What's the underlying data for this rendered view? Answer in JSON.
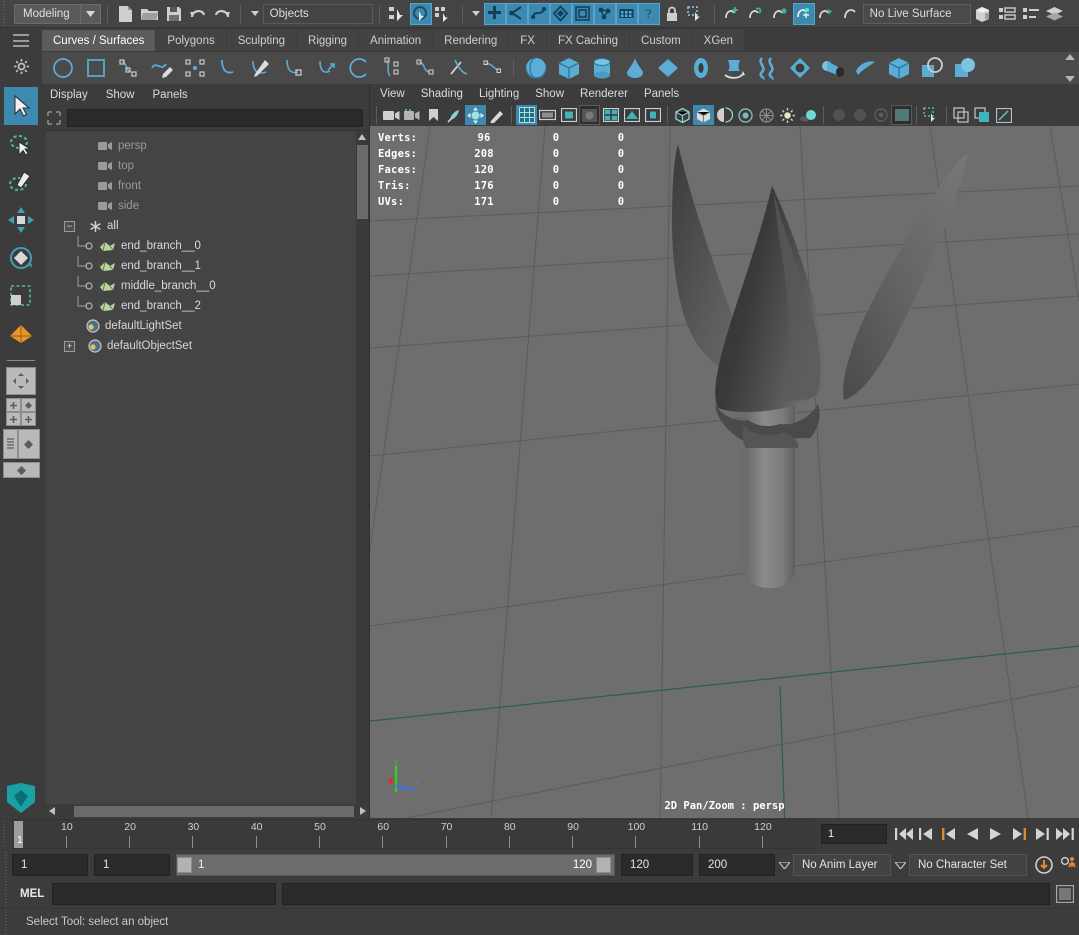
{
  "app": {
    "menu_set": "Modeling",
    "objects_field": "Objects",
    "live_surface": "No Live Surface"
  },
  "shelf": {
    "tabs": [
      {
        "label": "Curves / Surfaces",
        "active": true
      },
      {
        "label": "Polygons",
        "active": false
      },
      {
        "label": "Sculpting",
        "active": false
      },
      {
        "label": "Rigging",
        "active": false
      },
      {
        "label": "Animation",
        "active": false
      },
      {
        "label": "Rendering",
        "active": false
      },
      {
        "label": "FX",
        "active": false
      },
      {
        "label": "FX Caching",
        "active": false
      },
      {
        "label": "Custom",
        "active": false
      },
      {
        "label": "XGen",
        "active": false
      }
    ],
    "curve_icons": [
      "nurbs-circle-icon",
      "nurbs-square-icon",
      "cv-curve-icon",
      "pencil-curve-icon",
      "bezier-curve-icon",
      "curve-arc-icon",
      "curve-cut-icon",
      "insert-knot-icon",
      "extend-curve-icon",
      "arc-three-point-icon",
      "offset-curve-icon",
      "rebuild-curve-icon",
      "curve-fillet-icon",
      "attach-curve-icon"
    ],
    "surface_icons": [
      "sphere-icon",
      "cube-icon",
      "cylinder-icon",
      "cone-icon",
      "plane-icon",
      "torus-icon",
      "revolve-icon",
      "loft-icon",
      "planar-icon",
      "extrude-icon",
      "birail-icon",
      "boundary-cube-icon",
      "intersect-icon",
      "trim-icon"
    ]
  },
  "outliner": {
    "menus": [
      "Display",
      "Show",
      "Panels"
    ],
    "search_value": "",
    "search_placeholder": "",
    "items": [
      {
        "label": "persp",
        "icon": "camera-icon",
        "depth": 2,
        "dim": true
      },
      {
        "label": "top",
        "icon": "camera-icon",
        "depth": 2,
        "dim": true
      },
      {
        "label": "front",
        "icon": "camera-icon",
        "depth": 2,
        "dim": true
      },
      {
        "label": "side",
        "icon": "camera-icon",
        "depth": 2,
        "dim": true
      },
      {
        "label": "all",
        "icon": "set-star-icon",
        "depth": 1,
        "expanded": true,
        "dim": false
      },
      {
        "label": "end_branch__0",
        "icon": "mesh-icon",
        "depth": 3,
        "dim": false
      },
      {
        "label": "end_branch__1",
        "icon": "mesh-icon",
        "depth": 3,
        "dim": false
      },
      {
        "label": "middle_branch__0",
        "icon": "mesh-icon",
        "depth": 3,
        "dim": false
      },
      {
        "label": "end_branch__2",
        "icon": "mesh-icon",
        "depth": 3,
        "dim": false
      },
      {
        "label": "defaultLightSet",
        "icon": "set-sphere-icon",
        "depth": 2,
        "dim": false
      },
      {
        "label": "defaultObjectSet",
        "icon": "set-sphere-icon",
        "depth": 1,
        "collapsed": true,
        "dim": false
      }
    ]
  },
  "viewport": {
    "menus": [
      "View",
      "Shading",
      "Lighting",
      "Show",
      "Renderer",
      "Panels"
    ],
    "label": "2D Pan/Zoom : persp",
    "axis": {
      "y": "y",
      "z": "z"
    },
    "heads_up_display": {
      "columns": [
        "",
        "col1",
        "col2",
        "col3"
      ],
      "rows": [
        {
          "label": "Verts:",
          "total": "96",
          "selected": "0",
          "other": "0"
        },
        {
          "label": "Edges:",
          "total": "208",
          "selected": "0",
          "other": "0"
        },
        {
          "label": "Faces:",
          "total": "120",
          "selected": "0",
          "other": "0"
        },
        {
          "label": "Tris:",
          "total": "176",
          "selected": "0",
          "other": "0"
        },
        {
          "label": "UVs:",
          "total": "171",
          "selected": "0",
          "other": "0"
        }
      ]
    }
  },
  "toolbox": {
    "tools": [
      {
        "name": "select-tool-icon",
        "selected": true
      },
      {
        "name": "lasso-select-tool-icon",
        "selected": false
      },
      {
        "name": "paint-select-tool-icon",
        "selected": false
      },
      {
        "name": "move-tool-icon",
        "selected": false
      },
      {
        "name": "rotate-tool-icon",
        "selected": false
      },
      {
        "name": "scale-tool-icon",
        "selected": false
      },
      {
        "name": "soft-modification-tool-icon",
        "selected": false
      }
    ]
  },
  "timeline": {
    "start": 1,
    "end": 120,
    "ticks": [
      10,
      20,
      30,
      40,
      50,
      60,
      70,
      80,
      90,
      100,
      110,
      120
    ],
    "current_frame_marker": "1",
    "current_frame_field": "1",
    "playback_buttons": [
      "go-to-start-icon",
      "step-back-keyframe-icon",
      "step-back-frame-icon",
      "play-backwards-icon",
      "play-forwards-icon",
      "step-forward-frame-icon",
      "step-forward-keyframe-icon",
      "go-to-end-icon"
    ]
  },
  "range": {
    "anim_start": "1",
    "range_start": "1",
    "slider_min": "1",
    "slider_max": "120",
    "range_end": "120",
    "anim_end": "200",
    "anim_layer": "No Anim Layer",
    "character_set": "No Character Set"
  },
  "command_line": {
    "language": "MEL",
    "input_value": "",
    "result_value": ""
  },
  "status": {
    "message": "Select Tool: select an object"
  },
  "colors": {
    "accent_blue": "#3d89b0",
    "icon_blue": "#5badd6",
    "panel_bg": "#3c3c3c",
    "viewport_bg": "#6e6e6e",
    "text": "#c8c8c8",
    "orange": "#e08a30"
  }
}
